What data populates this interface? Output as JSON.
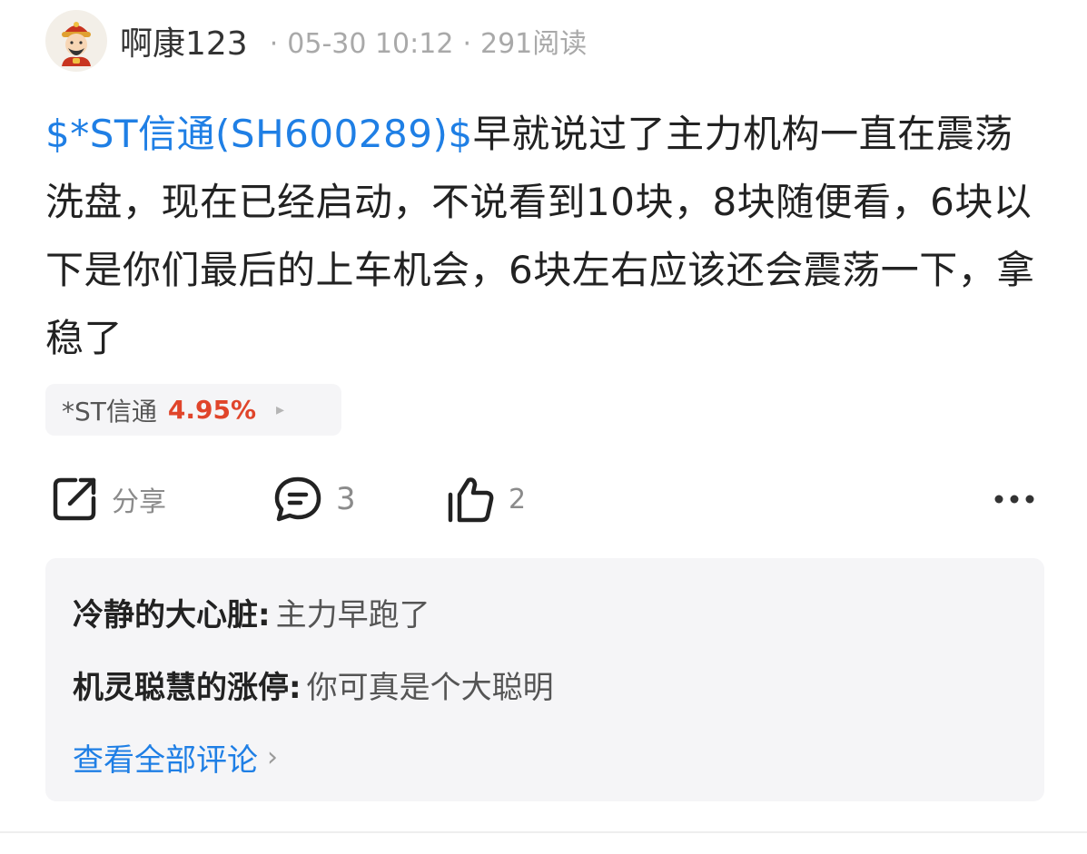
{
  "header": {
    "username": "啊康123",
    "date": "05-30 10:12",
    "reads": "291阅读",
    "separator": "·"
  },
  "post": {
    "stock_link": "$*ST信通(SH600289)$",
    "content": "早就说过了主力机构一直在震荡洗盘，现在已经启动，不说看到10块，8块随便看，6块以下是你们最后的上车机会，6块左右应该还会震荡一下，拿稳了"
  },
  "stock_tag": {
    "name": "*ST信通",
    "change": "4.95%",
    "arrow": "▸"
  },
  "actions": {
    "share_label": "分享",
    "comment_count": "3",
    "like_count": "2",
    "more_label": "•••"
  },
  "comments": [
    {
      "author": "冷静的大心脏",
      "text": "主力早跑了"
    },
    {
      "author": "机灵聪慧的涨停",
      "text": "你可真是个大聪明"
    }
  ],
  "view_all_label": "查看全部评论",
  "colors": {
    "link": "#1f7fe5",
    "up": "#e0452b"
  },
  "icons": {
    "avatar": "god-of-wealth-avatar-icon",
    "share": "share-icon",
    "comment": "comment-bubble-icon",
    "like": "thumbs-up-icon",
    "more": "more-dots-icon"
  }
}
